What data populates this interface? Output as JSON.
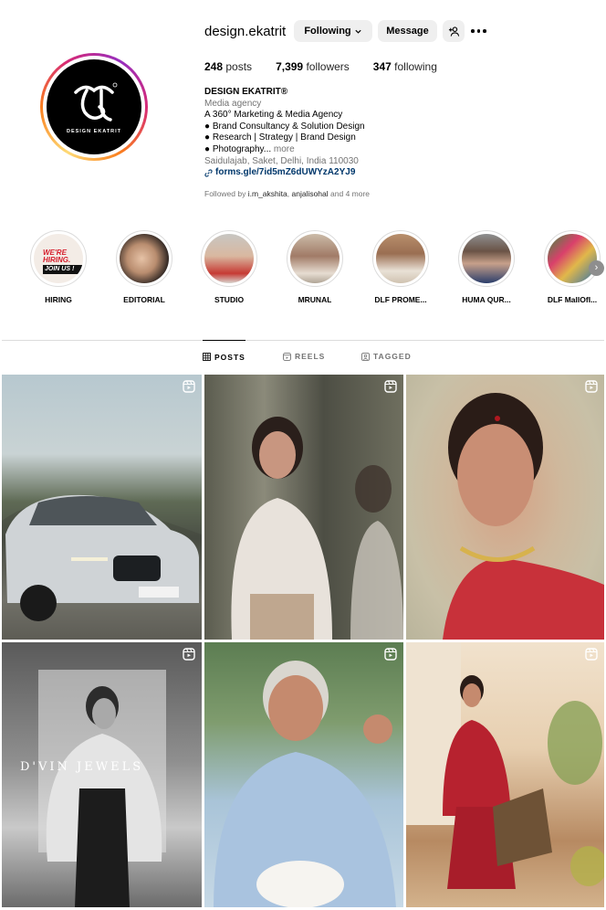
{
  "profile": {
    "username": "design.ekatrit",
    "avatar_caption": "DESIGN EKATRIT",
    "following_label": "Following",
    "message_label": "Message",
    "stats": {
      "posts_count": "248",
      "posts_label": "posts",
      "followers_count": "7,399",
      "followers_label": "followers",
      "following_count": "347",
      "following_label": "following"
    },
    "bio": {
      "name": "DESIGN EKATRIT®",
      "category": "Media agency",
      "line1": "A 360° Marketing & Media Agency",
      "line2": "● Brand Consultancy & Solution Design",
      "line3": "● Research | Strategy | Brand Design",
      "line4": "● Photography...",
      "more": "more",
      "location": "Saidulajab, Saket, Delhi, India 110030",
      "link": "forms.gle/7id5mZ6dUWYzA2YJ9"
    },
    "followed_by": {
      "prefix": "Followed by",
      "user1": "i.m_akshita",
      "sep": ",",
      "user2": "anjalisohal",
      "suffix": "and 4 more"
    }
  },
  "highlights": [
    {
      "label": "HIRING",
      "image_text_1": "WE'RE HIRING.",
      "image_text_2": "JOIN US !"
    },
    {
      "label": "EDITORIAL"
    },
    {
      "label": "STUDIO"
    },
    {
      "label": "MRUNAL"
    },
    {
      "label": "DLF PROME..."
    },
    {
      "label": "HUMA QUR..."
    },
    {
      "label": "DLF MallOfI..."
    }
  ],
  "tabs": [
    {
      "label": "POSTS",
      "icon": "grid-icon"
    },
    {
      "label": "REELS",
      "icon": "reels-icon"
    },
    {
      "label": "TAGGED",
      "icon": "tagged-icon"
    }
  ],
  "posts": {
    "post4_overlay_text": "D'VIN JEWELS"
  },
  "colors": {
    "link": "#00376b",
    "secondary_text": "#737373",
    "button_bg": "#efefef"
  }
}
